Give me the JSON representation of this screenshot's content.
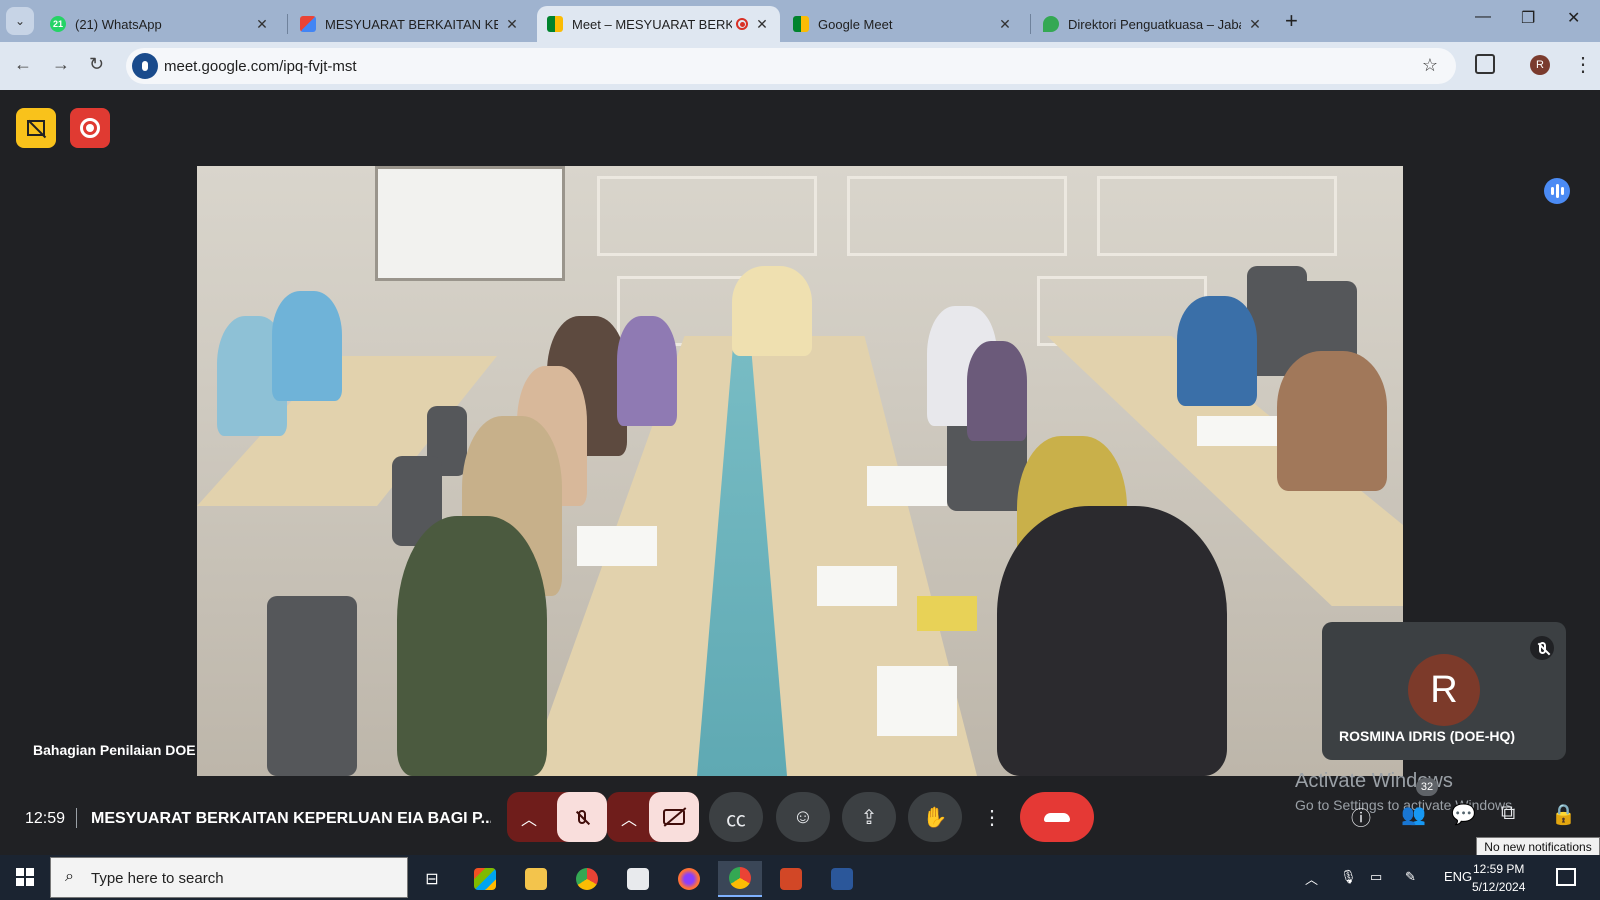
{
  "browser": {
    "tabs": [
      {
        "title": "(21) WhatsApp",
        "icon": "whatsapp-icon",
        "badge": "21"
      },
      {
        "title": "MESYUARAT BERKAITAN KEPER",
        "icon": "gmail-icon"
      },
      {
        "title": "Meet – MESYUARAT BERKA",
        "icon": "meet-icon",
        "recording": true,
        "active": true
      },
      {
        "title": "Google Meet",
        "icon": "meet-icon"
      },
      {
        "title": "Direktori Penguatkuasa – Jabat",
        "icon": "map-pin-icon"
      }
    ],
    "url": "meet.google.com/ipq-fvjt-mst",
    "profile_initial": "R"
  },
  "meet": {
    "participant_label": "Bahagian Penilaian DOE",
    "self_tile": {
      "initial": "R",
      "name": "ROSMINA IDRIS (DOE-HQ)"
    },
    "time": "12:59",
    "meeting_title": "MESYUARAT BERKAITAN KEPERLUAN EIA BAGI P...",
    "people_count": "32",
    "activate_windows": {
      "title": "Activate Windows",
      "subtitle": "Go to Settings to activate Windows."
    },
    "notification_tooltip": "No new notifications",
    "colors": {
      "hangup": "#e53935",
      "muted_bg": "#f9dedc",
      "record": "#e03a32",
      "no_share": "#f9c21b"
    }
  },
  "taskbar": {
    "search_placeholder": "Type here to search",
    "language": "ENG",
    "time": "12:59 PM",
    "date": "5/12/2024"
  }
}
